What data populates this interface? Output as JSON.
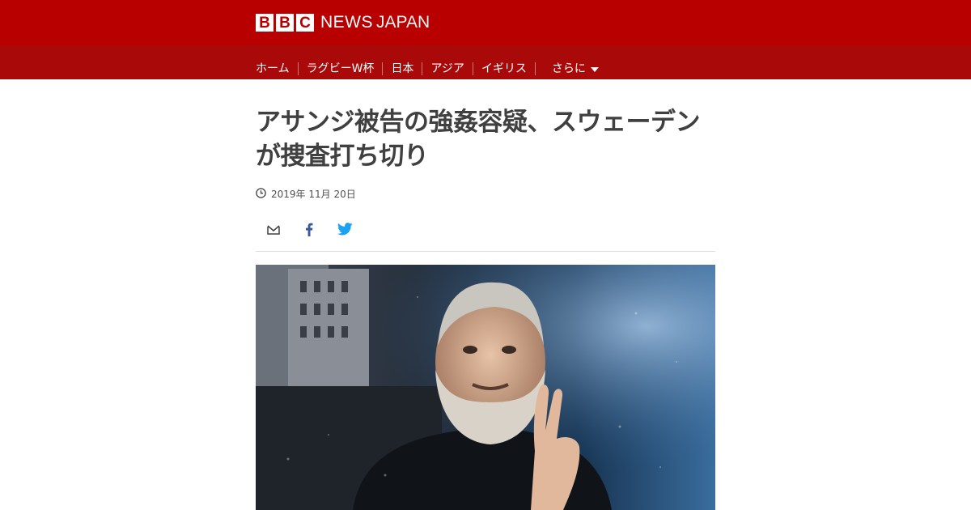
{
  "brand": {
    "letters": [
      "B",
      "B",
      "C"
    ],
    "news": "NEWS",
    "edition": "JAPAN"
  },
  "nav": {
    "items": [
      "ホーム",
      "ラグビーW杯",
      "日本",
      "アジア",
      "イギリス"
    ],
    "more": "さらに"
  },
  "article": {
    "headline_line1": "アサンジ被告の強姦容疑、スウェーデン",
    "headline_line2": "が捜査打ち切り",
    "date": "2019年 11月 20日"
  },
  "share": {
    "icons": [
      "email-icon",
      "facebook-icon",
      "twitter-icon"
    ]
  },
  "colors": {
    "masthead": "#b80000",
    "navbar": "#a90909",
    "twitter": "#1da1f2",
    "facebook": "#3b5998"
  }
}
